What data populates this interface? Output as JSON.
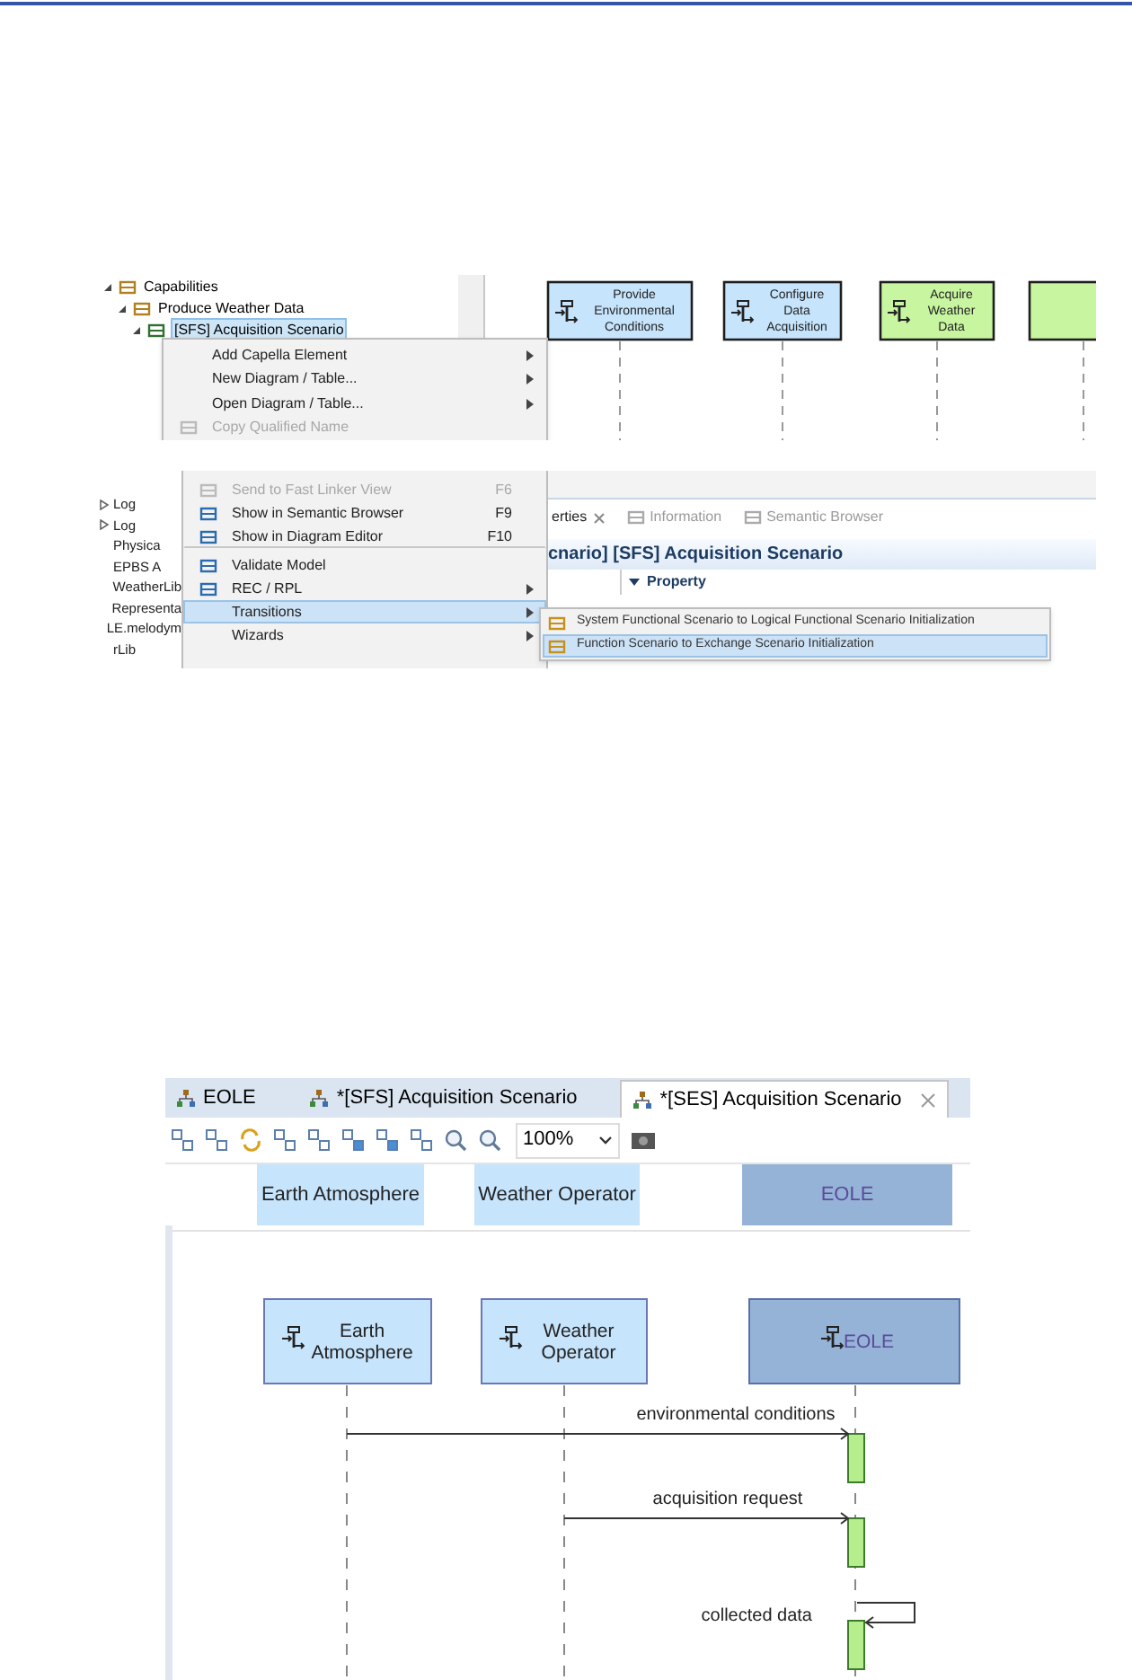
{
  "capture_top": {
    "model_tree": [
      {
        "label": "Capabilities",
        "expanded": true,
        "selected": false,
        "children": [
          {
            "label": "Produce Weather Data",
            "expanded": true,
            "selected": false,
            "children": [
              {
                "label": "[SFS] Acquisition Scenario",
                "expanded": true,
                "selected": true
              }
            ]
          }
        ]
      }
    ],
    "functions": [
      {
        "label": "Provide Environmental Conditions",
        "color": "#c6e4fc"
      },
      {
        "label": "Configure Data Acquisition",
        "color": "#c6e4fc"
      },
      {
        "label": "Acquire Weather Data",
        "color": "#c8f5a0"
      },
      {
        "color": "#c8f5a0"
      }
    ],
    "context_menu": [
      {
        "label": "Add Capella Element",
        "submenu": true,
        "disabled": false,
        "has_icon": false
      },
      {
        "label": "New Diagram / Table...",
        "submenu": true,
        "disabled": false,
        "has_icon": false
      },
      {
        "label": "Open Diagram / Table...",
        "submenu": true,
        "disabled": false,
        "has_icon": false
      },
      {
        "label": "Copy Qualified Name",
        "submenu": false,
        "disabled": true,
        "has_icon": true
      }
    ]
  },
  "capture_bottom": {
    "model_tree": [
      {
        "label": "Log",
        "expandable": true
      },
      {
        "label": "Log",
        "expandable": true
      },
      {
        "label": "Physica",
        "expandable": false
      },
      {
        "label": "EPBS A",
        "expandable": false
      },
      {
        "label": "WeatherLib",
        "expandable": false
      },
      {
        "label": "Representa",
        "expandable": false
      },
      {
        "label": "LE.melodym",
        "expandable": false
      },
      {
        "label": "rLib",
        "expandable": false
      }
    ],
    "context_menu": [
      {
        "label": "Send to Fast Linker View",
        "shortcut": "F6",
        "submenu": false,
        "disabled": true,
        "selected": false,
        "has_icon": true
      },
      {
        "label": "Show in Semantic Browser",
        "shortcut": "F9",
        "submenu": false,
        "disabled": false,
        "selected": false,
        "has_icon": true
      },
      {
        "label": "Show in Diagram Editor",
        "shortcut": "F10",
        "submenu": false,
        "disabled": false,
        "selected": false,
        "has_icon": true,
        "divider_after": true
      },
      {
        "label": "Validate Model",
        "submenu": false,
        "disabled": false,
        "selected": false,
        "has_icon": true
      },
      {
        "label": "REC / RPL",
        "submenu": true,
        "disabled": false,
        "selected": false,
        "has_icon": true
      },
      {
        "label": "Transitions",
        "submenu": true,
        "disabled": false,
        "selected": true,
        "has_icon": false
      },
      {
        "label": "Wizards",
        "submenu": true,
        "disabled": false,
        "selected": false,
        "has_icon": false
      }
    ],
    "properties": {
      "tabs": [
        {
          "label": "erties",
          "selected": true
        },
        {
          "label": "Information",
          "selected": false
        },
        {
          "label": "Semantic Browser",
          "selected": false
        }
      ],
      "title": "cnario] [SFS] Acquisition Scenario",
      "section": "Property"
    },
    "submenu": [
      {
        "label": "System Functional Scenario to Logical Functional Scenario Initialization",
        "selected": false
      },
      {
        "label": "Function Scenario to Exchange Scenario Initialization",
        "selected": true
      }
    ]
  },
  "capture_diagram": {
    "tabs": [
      {
        "label": "EOLE",
        "selected": false,
        "closable": false
      },
      {
        "label": "*[SFS] Acquisition Scenario",
        "selected": false,
        "closable": false
      },
      {
        "label": "*[SES] Acquisition Scenario",
        "selected": true,
        "closable": true
      }
    ],
    "zoom": "100%",
    "header_lifelines": [
      {
        "label": "Earth Atmosphere",
        "selected": false
      },
      {
        "label": "Weather Operator",
        "selected": false
      },
      {
        "label": "EOLE",
        "selected": true
      }
    ],
    "lifelines": [
      {
        "label": "Earth Atmosphere",
        "selected": false
      },
      {
        "label": "Weather Operator",
        "selected": false
      },
      {
        "label": "EOLE",
        "selected": true
      }
    ],
    "messages": [
      {
        "label": "environmental conditions",
        "kind": "call"
      },
      {
        "label": "acquisition request",
        "kind": "call"
      },
      {
        "label": "collected data",
        "kind": "self"
      }
    ]
  }
}
